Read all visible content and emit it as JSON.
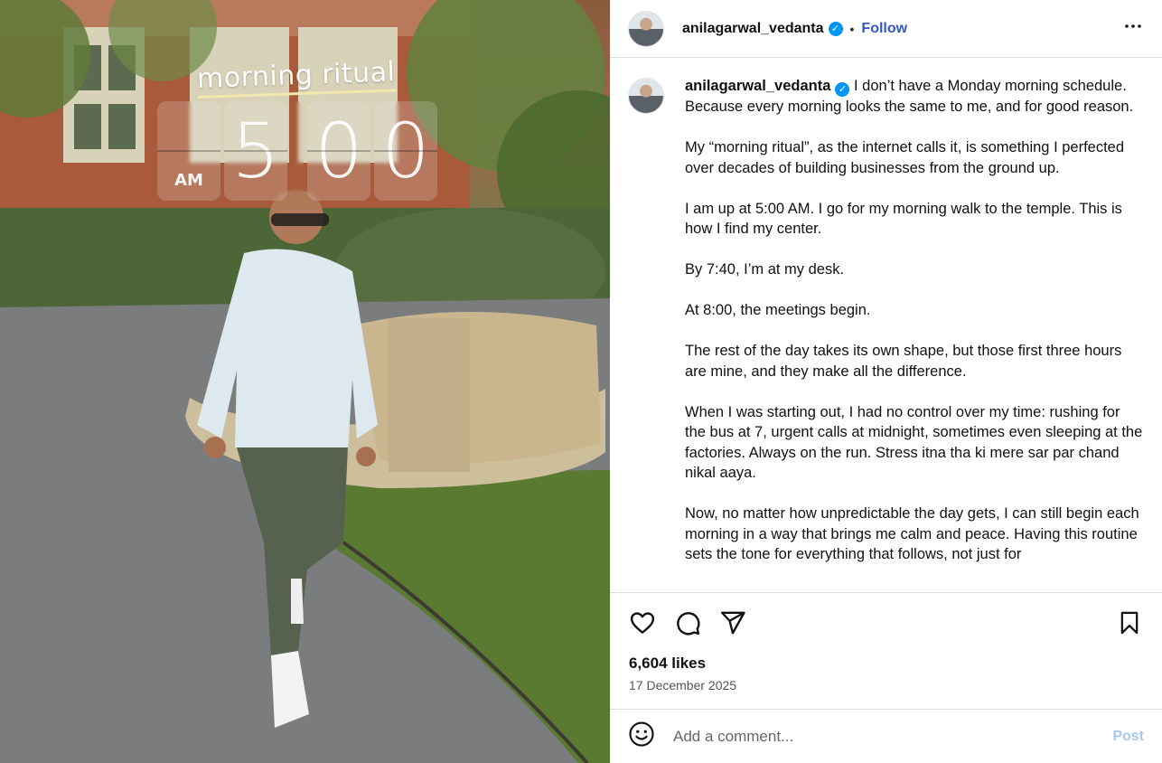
{
  "photo": {
    "overlay_text": "morning ritual",
    "clock": {
      "ampm": "AM",
      "hour": "5",
      "minute_tens": "0",
      "minute_ones": "0"
    }
  },
  "post": {
    "username": "anilagarwal_vedanta",
    "verified": "✓",
    "separator": "•",
    "follow_label": "Follow",
    "more_label": "•••",
    "caption_lines": [
      "I don’t have a Monday morning schedule. Because every morning looks the same to me, and for good reason.",
      "My “morning ritual”, as the internet calls it, is something I perfected over decades of building businesses from the ground up.",
      "I am up at 5:00 AM. I go for my morning walk to the temple. This is how I find my center.",
      "By 7:40, I’m at my desk.",
      "At 8:00, the meetings begin.",
      "The rest of the day takes its own shape, but those first three hours are mine, and they make all the difference.",
      "When I was starting out, I had no control over my time: rushing for the bus at 7, urgent calls at midnight, sometimes even sleeping at the factories. Always on the run. Stress itna tha ki mere sar par chand nikal aaya.",
      "Now, no matter how unpredictable the day gets, I can still begin each morning in a way that brings me calm and peace. Having this routine sets the tone for everything that follows, not just for"
    ],
    "likes": "6,604 likes",
    "date": "17 December 2025"
  },
  "icons": {
    "like": "heart-icon",
    "comment": "comment-icon",
    "share": "share-icon",
    "save": "bookmark-icon",
    "emoji": "emoji-icon"
  },
  "comment": {
    "placeholder": "Add a comment...",
    "post_label": "Post"
  },
  "colors": {
    "follow": "#3455c9",
    "verified": "#0095f6",
    "post_disabled": "#a7c8ee",
    "divider": "#dbdbdb"
  }
}
